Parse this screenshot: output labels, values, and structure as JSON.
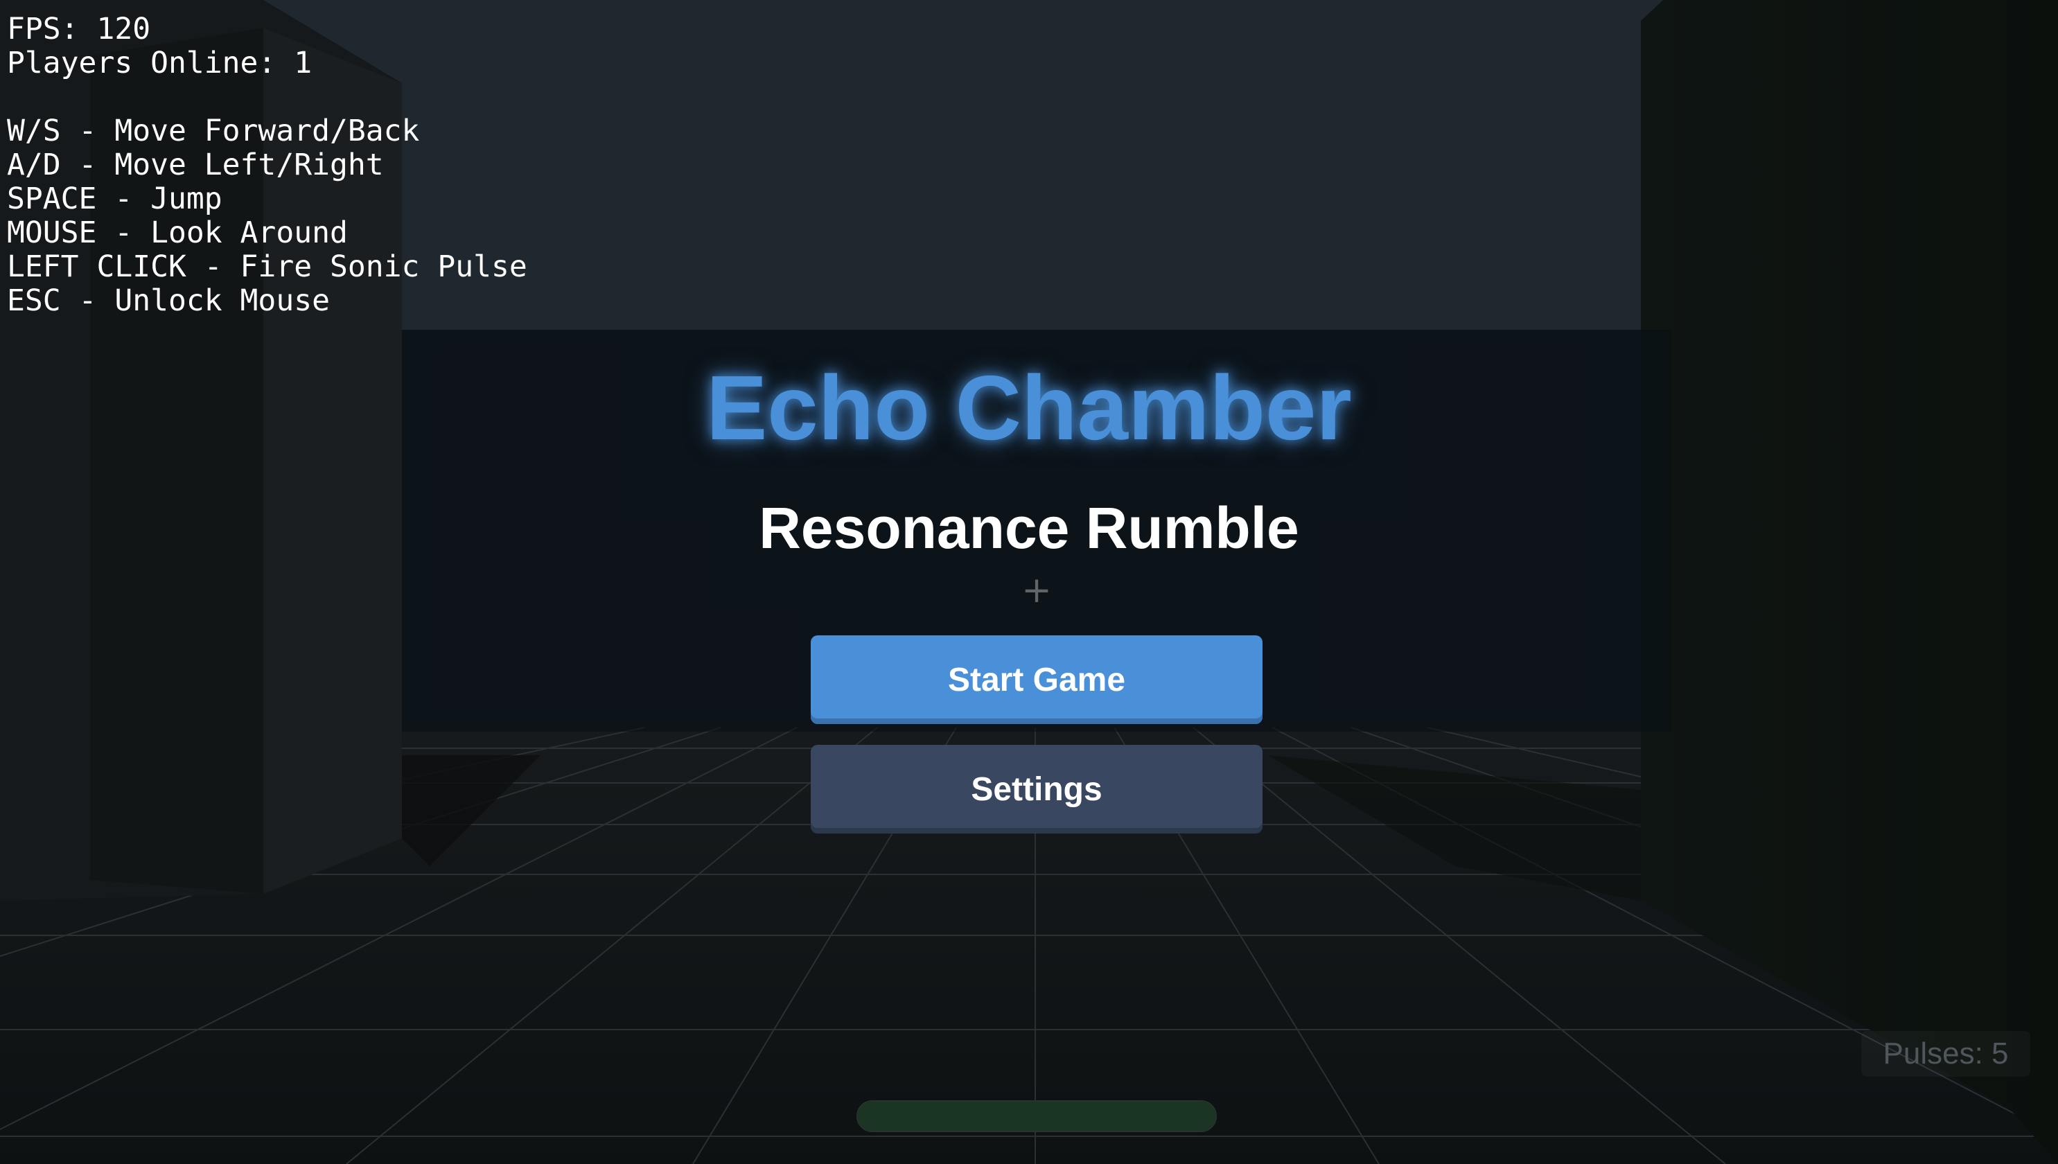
{
  "hud": {
    "fps": "FPS: 120",
    "players_online": "Players Online: 1",
    "controls": [
      "W/S - Move Forward/Back",
      "A/D - Move Left/Right",
      "SPACE - Jump",
      "MOUSE - Look Around",
      "LEFT CLICK - Fire Sonic Pulse",
      "ESC - Unlock Mouse"
    ]
  },
  "menu": {
    "title": "Echo Chamber",
    "subtitle": "Resonance Rumble",
    "start_label": "Start Game",
    "settings_label": "Settings"
  },
  "crosshair": "+",
  "pulses": "Pulses: 5",
  "charge_fraction": 1.0,
  "colors": {
    "accent": "#4a90d9",
    "settings_button": "#394860",
    "charge_bar": "#1b3524",
    "sky": "#1d272d",
    "floor": "#111416"
  },
  "icons": {
    "crosshair": "crosshair-icon"
  }
}
